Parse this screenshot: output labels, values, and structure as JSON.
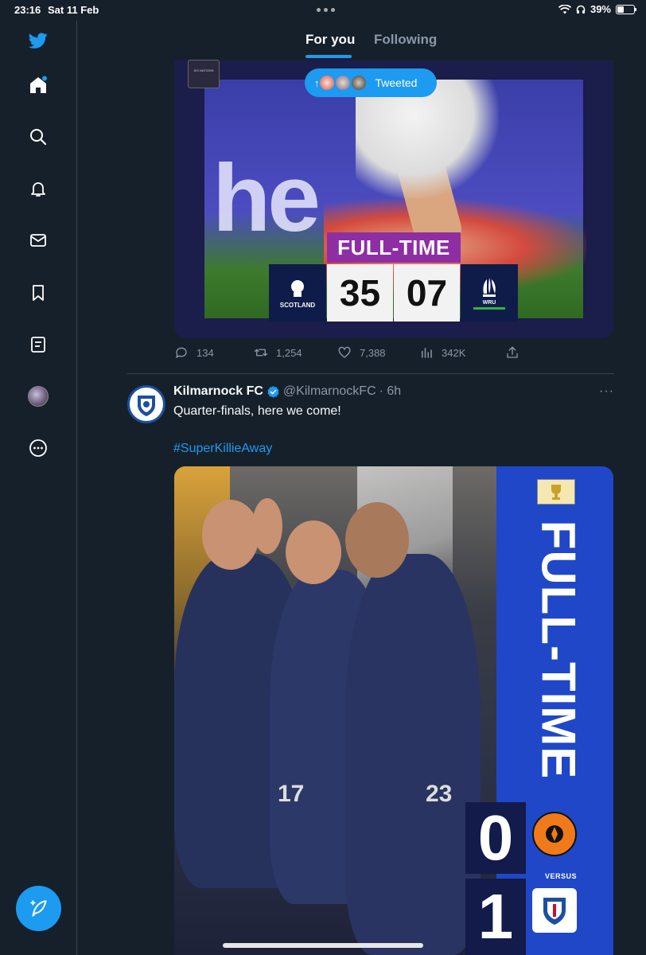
{
  "status_bar": {
    "time": "23:16",
    "date": "Sat 11 Feb",
    "battery": "39%"
  },
  "sidebar": {
    "items": [
      {
        "name": "twitter-logo-icon"
      },
      {
        "name": "home-icon"
      },
      {
        "name": "search-icon"
      },
      {
        "name": "notifications-icon"
      },
      {
        "name": "messages-icon"
      },
      {
        "name": "bookmarks-icon"
      },
      {
        "name": "lists-icon"
      },
      {
        "name": "profile-avatar"
      },
      {
        "name": "more-icon"
      }
    ],
    "compose": "compose-tweet-icon"
  },
  "tabs": {
    "for_you": "For you",
    "following": "Following"
  },
  "tweet1": {
    "media": {
      "tweeted_label": "Tweeted",
      "full_time": "FULL-TIME",
      "home_team": "SCOTLAND",
      "home_score": "35",
      "away_score": "07",
      "away_team": "WRU",
      "competition": "SIX NATIONS",
      "wordmark": "he"
    },
    "actions": {
      "replies": "134",
      "retweets": "1,254",
      "likes": "7,388",
      "views": "342K"
    }
  },
  "tweet2": {
    "name": "Kilmarnock FC",
    "handle": "@KilmarnockFC",
    "time": "· 6h",
    "more": "···",
    "text": "Quarter-finals, here we come!",
    "hashtag": "#SuperKillieAway",
    "media": {
      "full_time": "FULL-TIME",
      "home_score": "0",
      "away_score": "1",
      "versus": "VERSUS",
      "jersey_number_1": "17",
      "jersey_number_2": "23"
    }
  },
  "colors": {
    "background": "#15202b",
    "accent": "#1d9bf0",
    "muted": "#8b98a5"
  }
}
